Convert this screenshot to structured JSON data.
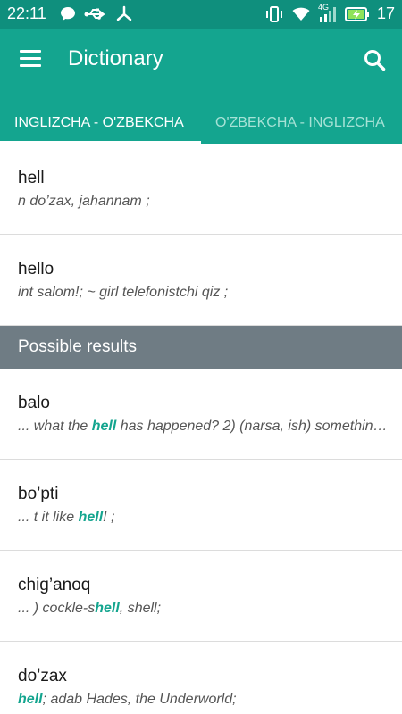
{
  "status_bar": {
    "time": "22:11",
    "network": "4G",
    "battery_level": "17"
  },
  "app_bar": {
    "title": "Dictionary"
  },
  "tabs": [
    {
      "label": "INGLIZCHA - O'ZBEKCHA",
      "selected": true
    },
    {
      "label": "O'ZBEKCHA - INGLIZCHA",
      "selected": false
    }
  ],
  "results": [
    {
      "word": "hell",
      "definition": "n do’zax, jahannam ;"
    },
    {
      "word": "hello",
      "definition": "int salom!; ~ girl telefonistchi qiz ;"
    }
  ],
  "possible": {
    "header": "Possible results",
    "items": [
      {
        "word": "balo",
        "def_before": "...  what the ",
        "def_hl": "hell",
        "def_after": " has happened?  2) (narsa, ish) somethin…"
      },
      {
        "word": "bo’pti",
        "def_before": "... t it like ",
        "def_hl": "hell",
        "def_after": "! ;"
      },
      {
        "word": "chig’anoq",
        "def_before": "... ) cockle-s",
        "def_hl": "hell",
        "def_after": ", shell;"
      },
      {
        "word": "do’zax",
        "def_before": "",
        "def_hl": "hell",
        "def_after": "; adab Hades, the Underworld;"
      }
    ]
  },
  "colors": {
    "primary": "#14a58f",
    "status_bar": "#0f8f7d",
    "section_header": "#6f7c84"
  }
}
